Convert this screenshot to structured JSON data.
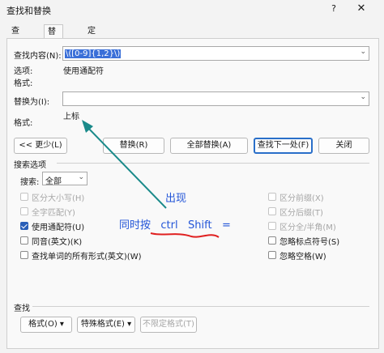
{
  "window": {
    "title": "查找和替换",
    "help": "?",
    "close": "✕"
  },
  "tabs": [
    "查找(D)",
    "替换(P)",
    "定位(G)"
  ],
  "find": {
    "label": "查找内容(N):",
    "value": "\\([0-9]{1,2}\\)",
    "options_label": "选项:",
    "options_value": "使用通配符",
    "format_label": "格式:"
  },
  "replace": {
    "label": "替换为(I):",
    "value": "",
    "format_label": "格式:",
    "format_value": "上标"
  },
  "buttons": {
    "less": "<< 更少(L)",
    "replace": "替换(R)",
    "replace_all": "全部替换(A)",
    "find_next": "查找下一处(F)",
    "close": "关闭"
  },
  "search_options": {
    "header": "搜索选项",
    "search_label": "搜索:",
    "search_value": "全部"
  },
  "checkboxes_left": [
    {
      "label": "区分大小写(H)",
      "checked": false,
      "disabled": true
    },
    {
      "label": "全字匹配(Y)",
      "checked": false,
      "disabled": true
    },
    {
      "label": "使用通配符(U)",
      "checked": true,
      "disabled": false
    },
    {
      "label": "同音(英文)(K)",
      "checked": false,
      "disabled": false
    },
    {
      "label": "查找单词的所有形式(英文)(W)",
      "checked": false,
      "disabled": false
    }
  ],
  "checkboxes_right": [
    {
      "label": "区分前缀(X)",
      "checked": false,
      "disabled": true
    },
    {
      "label": "区分后缀(T)",
      "checked": false,
      "disabled": true
    },
    {
      "label": "区分全/半角(M)",
      "checked": false,
      "disabled": true
    },
    {
      "label": "忽略标点符号(S)",
      "checked": false,
      "disabled": false
    },
    {
      "label": "忽略空格(W)",
      "checked": false,
      "disabled": false
    }
  ],
  "find_section": {
    "header": "查找",
    "format_btn": "格式(O) ▾",
    "special_btn": "特殊格式(E) ▾",
    "no_format_btn": "不限定格式(T)"
  },
  "annotations": {
    "appears": "出现",
    "press": "同时按   ctrl   Shift   =",
    "accent": "#2456d8",
    "arrow_color": "#1a8a8a",
    "underline_color": "#e02020"
  }
}
